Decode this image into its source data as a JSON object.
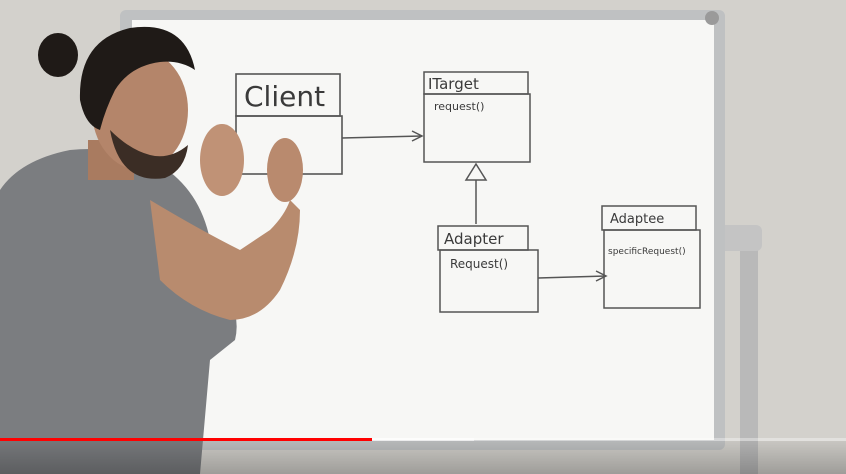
{
  "whiteboard": {
    "client_label": "Client",
    "itarget_label": "ITarget",
    "itarget_method": "request()",
    "adapter_label": "Adapter",
    "adapter_method": "Request()",
    "adaptee_label": "Adaptee",
    "adaptee_method": "specificRequest()"
  },
  "player": {
    "played_fraction": 0.44,
    "buffered_fraction": 0.56,
    "accent_color": "#ff0000"
  }
}
